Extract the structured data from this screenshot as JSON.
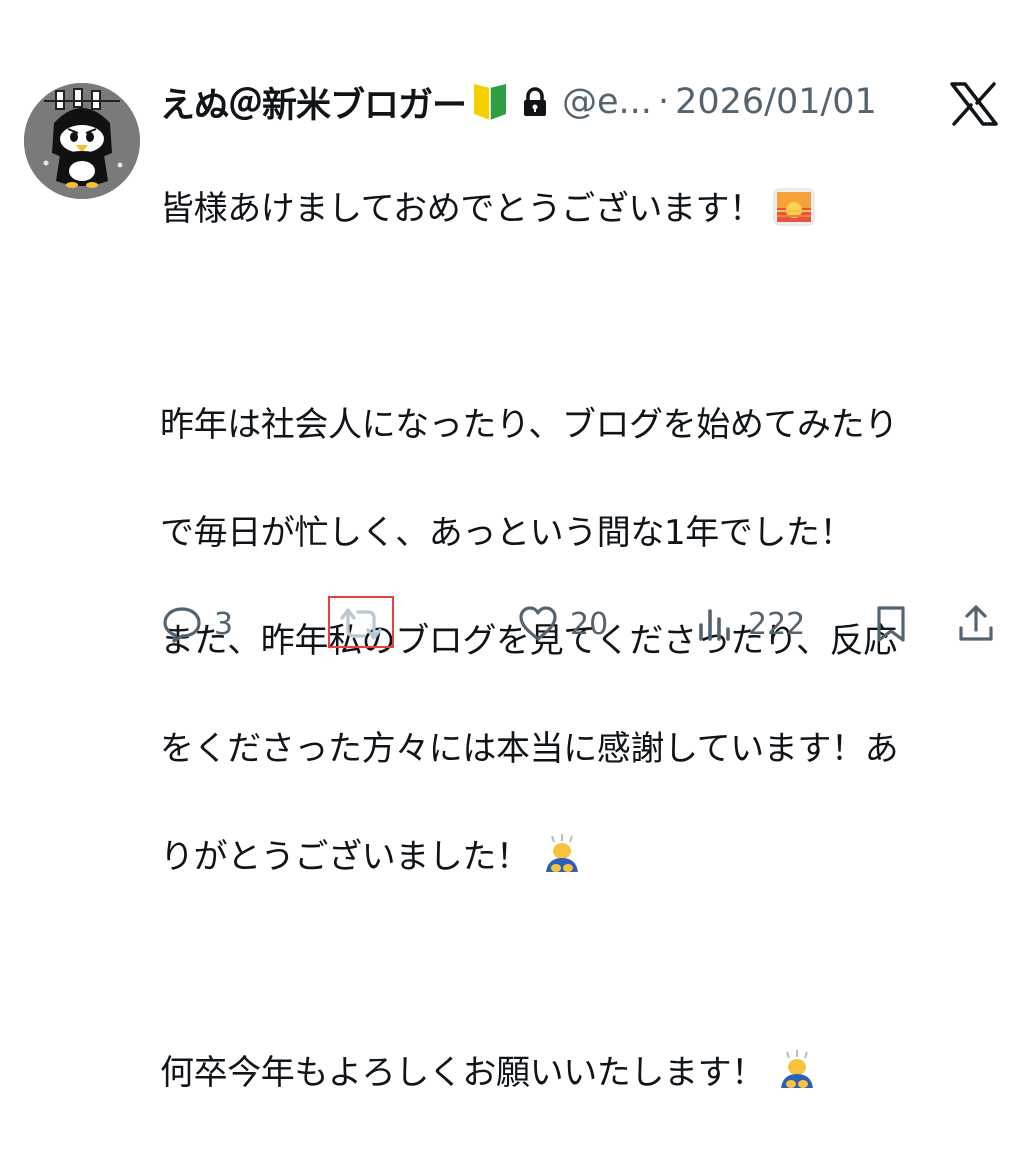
{
  "tweet": {
    "author_name": "えぬ＠新米ブロガー",
    "badge_icon": "beginner-mark-icon",
    "lock_icon": "lock-icon",
    "handle": "@e...",
    "separator": "·",
    "date": "2026/01/01",
    "lines": [
      "皆様あけましておめでとうございます！",
      "",
      "昨年は社会人になったり、ブログを始めてみたり",
      "で毎日が忙しく、あっという間な1年でした！",
      "また、昨年私のブログを見てくださったり、反応",
      "をくださった方々には本当に感謝しています！あ",
      "りがとうございました！",
      "",
      "何卒今年もよろしくお願いいたします！"
    ]
  },
  "actions": {
    "reply_count": "3",
    "like_count": "20",
    "views_count": "222"
  },
  "colors": {
    "text": "#0f1419",
    "secondary": "#536471",
    "highlight_box": "#e8413d"
  }
}
